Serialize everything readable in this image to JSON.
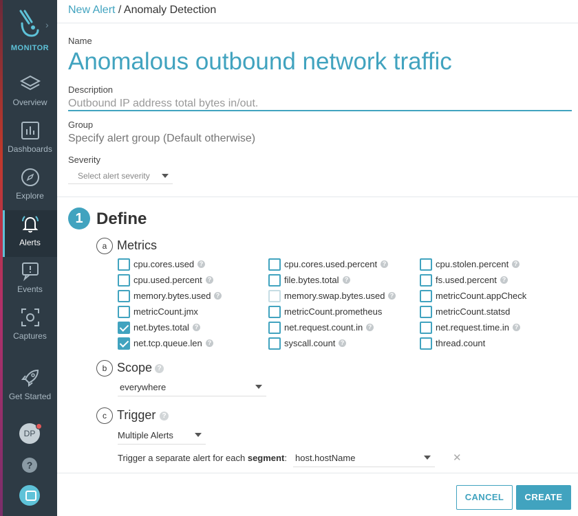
{
  "app": {
    "name": "MONITOR"
  },
  "nav": {
    "items": [
      {
        "label": "Overview",
        "icon": "layers-icon"
      },
      {
        "label": "Dashboards",
        "icon": "bar-chart-icon"
      },
      {
        "label": "Explore",
        "icon": "compass-icon"
      },
      {
        "label": "Alerts",
        "icon": "bell-icon",
        "active": true
      },
      {
        "label": "Events",
        "icon": "events-icon"
      },
      {
        "label": "Captures",
        "icon": "capture-icon"
      },
      {
        "label": "Get Started",
        "icon": "rocket-icon"
      }
    ],
    "avatar_initials": "DP",
    "help_glyph": "?"
  },
  "breadcrumb": {
    "link": "New Alert",
    "separator": " / ",
    "current": "Anomaly Detection"
  },
  "form": {
    "name_label": "Name",
    "name_value": "Anomalous outbound network traffic",
    "description_label": "Description",
    "description_value": "Outbound IP address total bytes in/out.",
    "group_label": "Group",
    "group_placeholder": "Specify alert group (Default otherwise)",
    "severity_label": "Severity",
    "severity_placeholder": "Select alert severity"
  },
  "define": {
    "step_number": "1",
    "title": "Define",
    "metrics": {
      "letter": "a",
      "title": "Metrics",
      "columns": [
        [
          {
            "name": "cpu.cores.used",
            "checked": false,
            "help": true
          },
          {
            "name": "cpu.used.percent",
            "checked": false,
            "help": true
          },
          {
            "name": "memory.bytes.used",
            "checked": false,
            "help": true
          },
          {
            "name": "metricCount.jmx",
            "checked": false,
            "help": false
          },
          {
            "name": "net.bytes.total",
            "checked": true,
            "help": true
          },
          {
            "name": "net.tcp.queue.len",
            "checked": true,
            "help": true
          }
        ],
        [
          {
            "name": "cpu.cores.used.percent",
            "checked": false,
            "help": true
          },
          {
            "name": "file.bytes.total",
            "checked": false,
            "help": true
          },
          {
            "name": "memory.swap.bytes.used",
            "checked": false,
            "help": true,
            "faded": true
          },
          {
            "name": "metricCount.prometheus",
            "checked": false,
            "help": false
          },
          {
            "name": "net.request.count.in",
            "checked": false,
            "help": true
          },
          {
            "name": "syscall.count",
            "checked": false,
            "help": true
          }
        ],
        [
          {
            "name": "cpu.stolen.percent",
            "checked": false,
            "help": true
          },
          {
            "name": "fs.used.percent",
            "checked": false,
            "help": true
          },
          {
            "name": "metricCount.appCheck",
            "checked": false,
            "help": false
          },
          {
            "name": "metricCount.statsd",
            "checked": false,
            "help": false
          },
          {
            "name": "net.request.time.in",
            "checked": false,
            "help": true
          },
          {
            "name": "thread.count",
            "checked": false,
            "help": false
          }
        ]
      ]
    },
    "scope": {
      "letter": "b",
      "title": "Scope",
      "value": "everywhere"
    },
    "trigger": {
      "letter": "c",
      "title": "Trigger",
      "mode": "Multiple Alerts",
      "segment_prefix": "Trigger a separate alert for each ",
      "segment_word": "segment",
      "segment_suffix": ":",
      "segment_value": "host.hostName",
      "clear_glyph": "✕"
    }
  },
  "footer": {
    "cancel_label": "CANCEL",
    "create_label": "CREATE"
  },
  "colors": {
    "accent": "#41a3bf",
    "sidebar": "#2e3b45",
    "sidebar_text": "#a9b8c2",
    "logo": "#5ec2d8"
  }
}
